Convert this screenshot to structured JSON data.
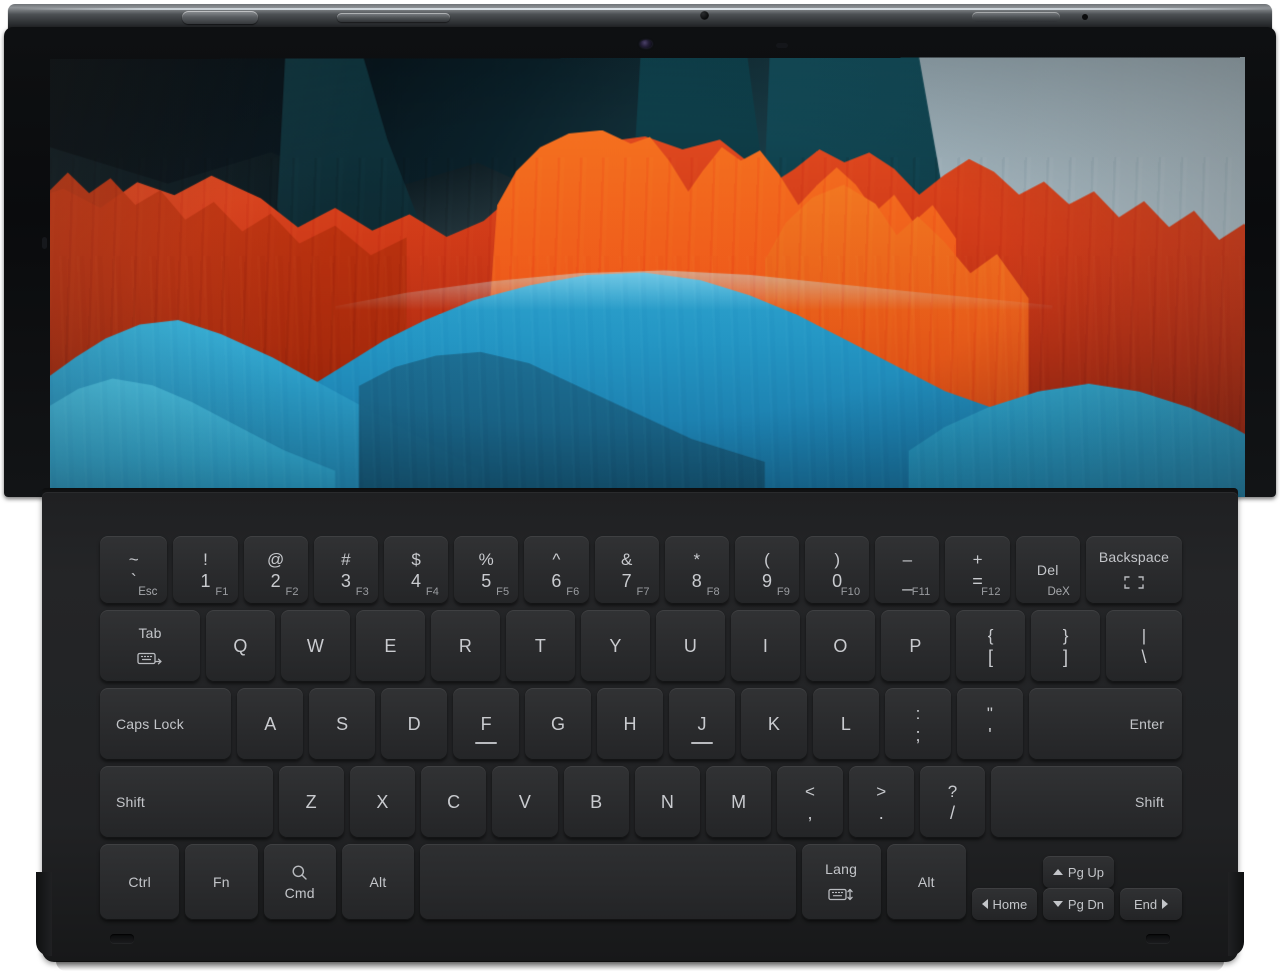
{
  "device": {
    "type": "tablet-with-keyboard-cover",
    "top_edge_controls": [
      "power-button",
      "volume-rocker",
      "mic-hole",
      "accessory-port"
    ],
    "front_camera": "front-camera",
    "wallpaper": {
      "name": "abstract-layered-mountains",
      "colors": {
        "sky": "#abbcc4",
        "dark_teal": "#0a2029",
        "orange": "#f4701f",
        "red": "#c2340f",
        "blue": "#2fa4cf",
        "deep_blue": "#16668f"
      }
    }
  },
  "keyboard": {
    "ports": {
      "left": "usb-c-port",
      "right": "usb-c-port"
    },
    "rows": [
      {
        "name": "number-row",
        "keys": [
          {
            "id": "esc",
            "up": "~",
            "down": "`",
            "sub": "Esc",
            "flex": 1.05
          },
          {
            "id": "1",
            "up": "!",
            "down": "1",
            "fn": "F1"
          },
          {
            "id": "2",
            "up": "@",
            "down": "2",
            "fn": "F2"
          },
          {
            "id": "3",
            "up": "#",
            "down": "3",
            "fn": "F3"
          },
          {
            "id": "4",
            "up": "$",
            "down": "4",
            "fn": "F4"
          },
          {
            "id": "5",
            "up": "%",
            "down": "5",
            "fn": "F5"
          },
          {
            "id": "6",
            "up": "^",
            "down": "6",
            "fn": "F6"
          },
          {
            "id": "7",
            "up": "&",
            "down": "7",
            "fn": "F7"
          },
          {
            "id": "8",
            "up": "*",
            "down": "8",
            "fn": "F8"
          },
          {
            "id": "9",
            "up": "(",
            "down": "9",
            "fn": "F9"
          },
          {
            "id": "0",
            "up": ")",
            "down": "0",
            "fn": "F10"
          },
          {
            "id": "minus",
            "up": "–",
            "down": "_",
            "fn": "F11"
          },
          {
            "id": "equal",
            "up": "+",
            "down": "=",
            "fn": "F12"
          },
          {
            "id": "del",
            "word": "Del",
            "sub": "DeX",
            "flex": 1.0
          },
          {
            "id": "backspace",
            "word": "Backspace",
            "icon": "dex-frame-icon",
            "flex": 1.5
          }
        ]
      },
      {
        "name": "qwerty-row",
        "keys": [
          {
            "id": "tab",
            "word": "Tab",
            "icon": "keyboard-tab-icon",
            "flex": 1.45
          },
          {
            "id": "q",
            "main": "Q"
          },
          {
            "id": "w",
            "main": "W"
          },
          {
            "id": "e",
            "main": "E"
          },
          {
            "id": "r",
            "main": "R"
          },
          {
            "id": "t",
            "main": "T"
          },
          {
            "id": "y",
            "main": "Y"
          },
          {
            "id": "u",
            "main": "U"
          },
          {
            "id": "i",
            "main": "I"
          },
          {
            "id": "o",
            "main": "O"
          },
          {
            "id": "p",
            "main": "P"
          },
          {
            "id": "bracket-left",
            "up": "{",
            "down": "["
          },
          {
            "id": "bracket-right",
            "up": "}",
            "down": "]"
          },
          {
            "id": "backslash",
            "up": "|",
            "down": "\\",
            "flex": 1.1
          }
        ]
      },
      {
        "name": "home-row",
        "keys": [
          {
            "id": "caps-lock",
            "word": "Caps Lock",
            "flex": 1.75
          },
          {
            "id": "a",
            "main": "A"
          },
          {
            "id": "s",
            "main": "S"
          },
          {
            "id": "d",
            "main": "D"
          },
          {
            "id": "f",
            "main": "F",
            "homing": true
          },
          {
            "id": "g",
            "main": "G"
          },
          {
            "id": "h",
            "main": "H"
          },
          {
            "id": "j",
            "main": "J",
            "homing": true
          },
          {
            "id": "k",
            "main": "K"
          },
          {
            "id": "l",
            "main": "L"
          },
          {
            "id": "semicolon",
            "up": ":",
            "down": ";"
          },
          {
            "id": "quote",
            "up": "\"",
            "down": "'"
          },
          {
            "id": "enter",
            "word": "Enter",
            "flex": 2.05
          }
        ]
      },
      {
        "name": "shift-row",
        "keys": [
          {
            "id": "shift-left",
            "word": "Shift",
            "align": "left",
            "flex": 2.4
          },
          {
            "id": "z",
            "main": "Z"
          },
          {
            "id": "x",
            "main": "X"
          },
          {
            "id": "c",
            "main": "C"
          },
          {
            "id": "v",
            "main": "V"
          },
          {
            "id": "b",
            "main": "B"
          },
          {
            "id": "n",
            "main": "N"
          },
          {
            "id": "m",
            "main": "M"
          },
          {
            "id": "comma",
            "up": "<",
            "down": ","
          },
          {
            "id": "period",
            "up": ">",
            "down": "."
          },
          {
            "id": "slash",
            "up": "?",
            "down": "/"
          },
          {
            "id": "shift-right",
            "word": "Shift",
            "align": "right",
            "flex": 2.65
          }
        ]
      },
      {
        "name": "bottom-row",
        "keys": [
          {
            "id": "ctrl",
            "word": "Ctrl",
            "flex": 1.15
          },
          {
            "id": "fn",
            "word": "Fn",
            "flex": 1.05
          },
          {
            "id": "cmd",
            "word": "Cmd",
            "icon": "search-icon",
            "icon_position": "above",
            "flex": 1.05
          },
          {
            "id": "alt-left",
            "word": "Alt",
            "flex": 1.05
          },
          {
            "id": "space",
            "word": "",
            "flex": 5.45
          },
          {
            "id": "lang",
            "word": "Lang",
            "icon": "keyboard-switch-icon",
            "flex": 1.15
          },
          {
            "id": "alt-right",
            "word": "Alt",
            "flex": 1.15
          }
        ],
        "nav_keys": [
          {
            "id": "home",
            "label": "Home",
            "arrow": "left"
          },
          {
            "id": "pg-up",
            "label": "Pg Up",
            "arrow": "up"
          },
          {
            "id": "pg-dn",
            "label": "Pg Dn",
            "arrow": "down"
          },
          {
            "id": "end",
            "label": "End",
            "arrow": "right"
          }
        ]
      }
    ]
  },
  "icons": {
    "search-icon": "magnifier",
    "keyboard-tab-icon": "keyboard-with-right-arrow",
    "keyboard-switch-icon": "keyboard-with-updown-arrow",
    "dex-frame-icon": "corner-brackets-frame"
  }
}
